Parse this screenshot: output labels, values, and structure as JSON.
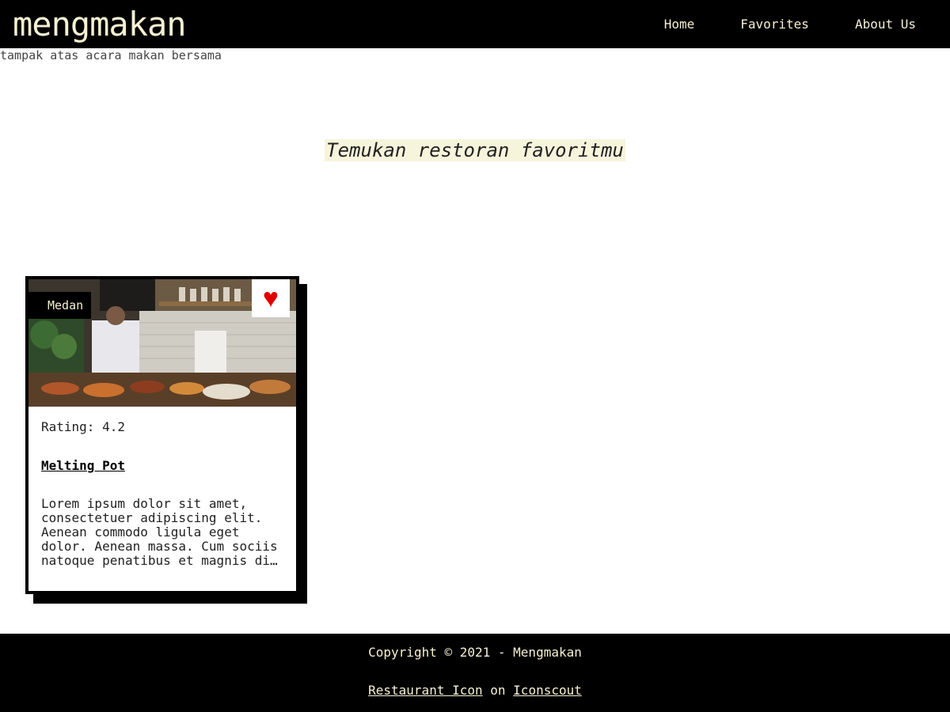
{
  "header": {
    "brand": "mengmakan",
    "nav": [
      {
        "label": "Home"
      },
      {
        "label": "Favorites"
      },
      {
        "label": "About Us"
      }
    ]
  },
  "hero": {
    "image_alt": "tampak atas acara makan bersama",
    "tagline": "Temukan restoran favoritmu"
  },
  "restaurants": [
    {
      "city": "Medan",
      "favorite_icon": "heart-icon",
      "rating_label": "Rating: 4.2",
      "name": "Melting Pot",
      "description": "Lorem ipsum dolor sit amet, consectetuer adipiscing elit. Aenean commodo ligula eget dolor. Aenean massa. Cum sociis natoque penatibus et magnis dis parturient montes, nascetur ridiculus mus."
    }
  ],
  "footer": {
    "copyright": "Copyright © 2021 - Mengmakan",
    "credit_link1": "Restaurant Icon",
    "credit_on": "on",
    "credit_link2": "Iconscout"
  },
  "colors": {
    "nav_bg": "#000000",
    "nav_text": "#f5f0d2",
    "tagline_bg": "#f7f4dc",
    "favorite_heart": "#e00000"
  }
}
